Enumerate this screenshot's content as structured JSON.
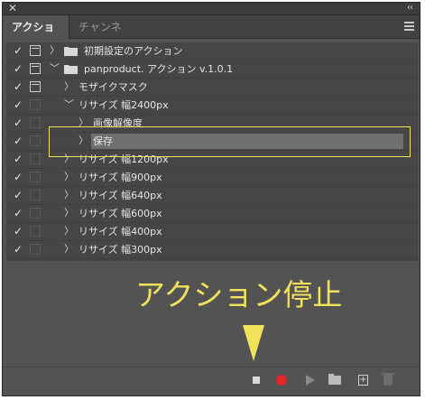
{
  "window": {
    "close_glyph": "✕",
    "collapse_glyph": "‹‹"
  },
  "tabs": [
    {
      "label": "アクション",
      "active": true
    },
    {
      "label": "チャンネル",
      "active": false
    }
  ],
  "icons": {
    "check": "✓",
    "chevron_right": "〉",
    "chevron_down": "﹀",
    "menu": "panel-menu-icon"
  },
  "rows": [
    {
      "checked": true,
      "dialog": true,
      "expanded": false,
      "kind": "set",
      "label": "初期設定のアクション"
    },
    {
      "checked": true,
      "dialog": true,
      "expanded": true,
      "kind": "set",
      "label": "panproduct. アクション v.1.0.1"
    },
    {
      "checked": true,
      "dialog": true,
      "expanded": false,
      "kind": "action",
      "label": "モザイクマスク"
    },
    {
      "checked": true,
      "dialog": false,
      "expanded": true,
      "kind": "action",
      "label": "リサイズ  幅2400px"
    },
    {
      "checked": true,
      "dialog": false,
      "expanded": false,
      "kind": "step",
      "label": "画像解像度"
    },
    {
      "checked": true,
      "dialog": false,
      "expanded": false,
      "kind": "step",
      "label": "保存",
      "selected": true
    },
    {
      "checked": true,
      "dialog": false,
      "expanded": false,
      "kind": "action",
      "label": "リサイズ  幅1200px"
    },
    {
      "checked": true,
      "dialog": false,
      "expanded": false,
      "kind": "action",
      "label": "リサイズ  幅900px"
    },
    {
      "checked": true,
      "dialog": false,
      "expanded": false,
      "kind": "action",
      "label": "リサイズ  幅640px"
    },
    {
      "checked": true,
      "dialog": false,
      "expanded": false,
      "kind": "action",
      "label": "リサイズ  幅600px"
    },
    {
      "checked": true,
      "dialog": false,
      "expanded": false,
      "kind": "action",
      "label": "リサイズ  幅400px"
    },
    {
      "checked": true,
      "dialog": false,
      "expanded": false,
      "kind": "action",
      "label": "リサイズ  幅300px"
    }
  ],
  "annotation": {
    "text": "アクション停止"
  },
  "bottom_toolbar": [
    {
      "name": "stop-button",
      "icon": "stop-icon"
    },
    {
      "name": "record-button",
      "icon": "record-icon"
    },
    {
      "name": "play-button",
      "icon": "play-icon"
    },
    {
      "name": "new-set-button",
      "icon": "folder-icon"
    },
    {
      "name": "new-action-button",
      "icon": "new-action-icon"
    },
    {
      "name": "delete-button",
      "icon": "trash-icon"
    }
  ],
  "colors": {
    "highlight": "#f2e25b",
    "record": "#e32626",
    "panel": "#535353",
    "list": "#464646"
  }
}
